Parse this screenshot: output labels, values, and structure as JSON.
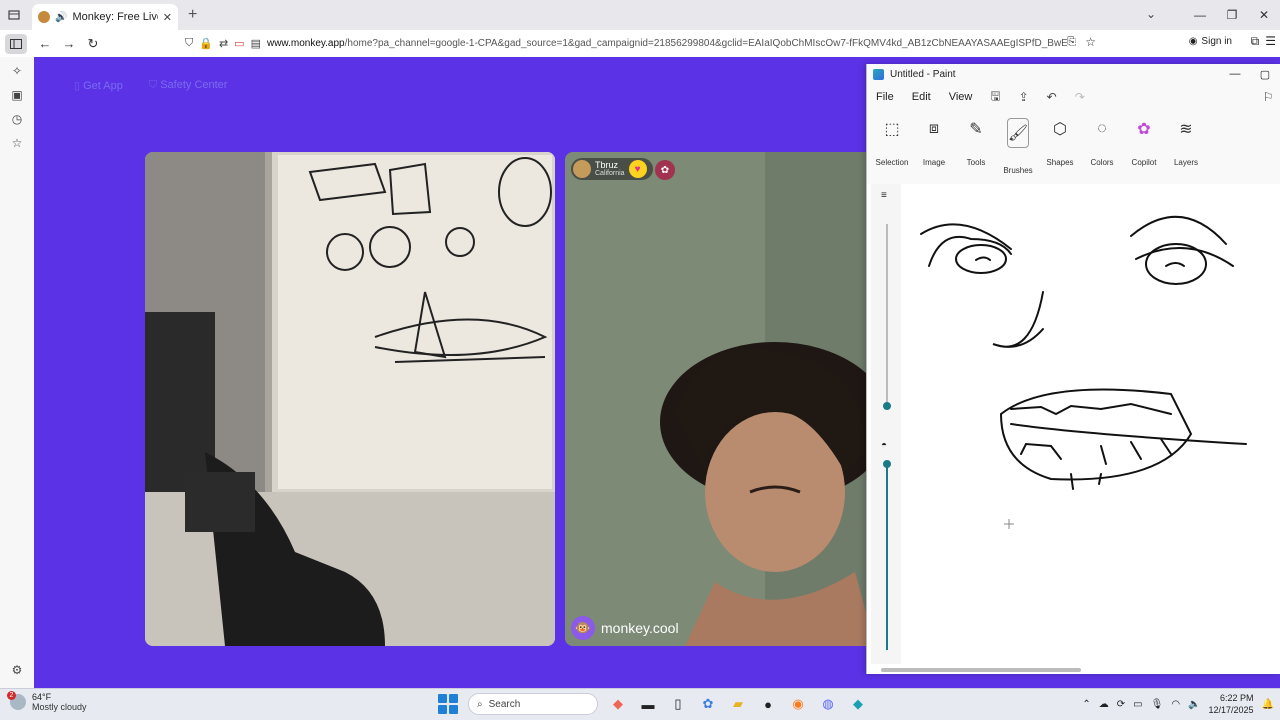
{
  "browser": {
    "tab_title": "Monkey: Free Live Video C",
    "url_host": "www.monkey.app",
    "url_path": "/home?pa_channel=google-1-CPA&gad_source=1&gad_campaignid=21856299804&gclid=EAIaIQobChMIscOw7-fFkQMV4kd_AB1zCbNEAAYASAAEgISPfD_BwE",
    "signin_label": "Sign in"
  },
  "page": {
    "header_items": [
      {
        "label": "Get App",
        "icon": "phone-icon"
      },
      {
        "label": "Safety Center",
        "icon": "shield-icon"
      }
    ],
    "remote_user": {
      "name": "Tbruz",
      "location": "California"
    },
    "watermark": "monkey.cool"
  },
  "paint": {
    "window_title": "Untitled - Paint",
    "menu": [
      "File",
      "Edit",
      "View"
    ],
    "ribbon": [
      "Selection",
      "Image",
      "Tools",
      "Brushes",
      "Shapes",
      "Colors",
      "Copilot",
      "Layers"
    ],
    "accent": "#1a7a86"
  },
  "taskbar": {
    "weather_temp": "64°F",
    "weather_desc": "Mostly cloudy",
    "weather_badge": "2",
    "search_label": "Search",
    "time": "6:22 PM",
    "date": "12/17/2025"
  }
}
